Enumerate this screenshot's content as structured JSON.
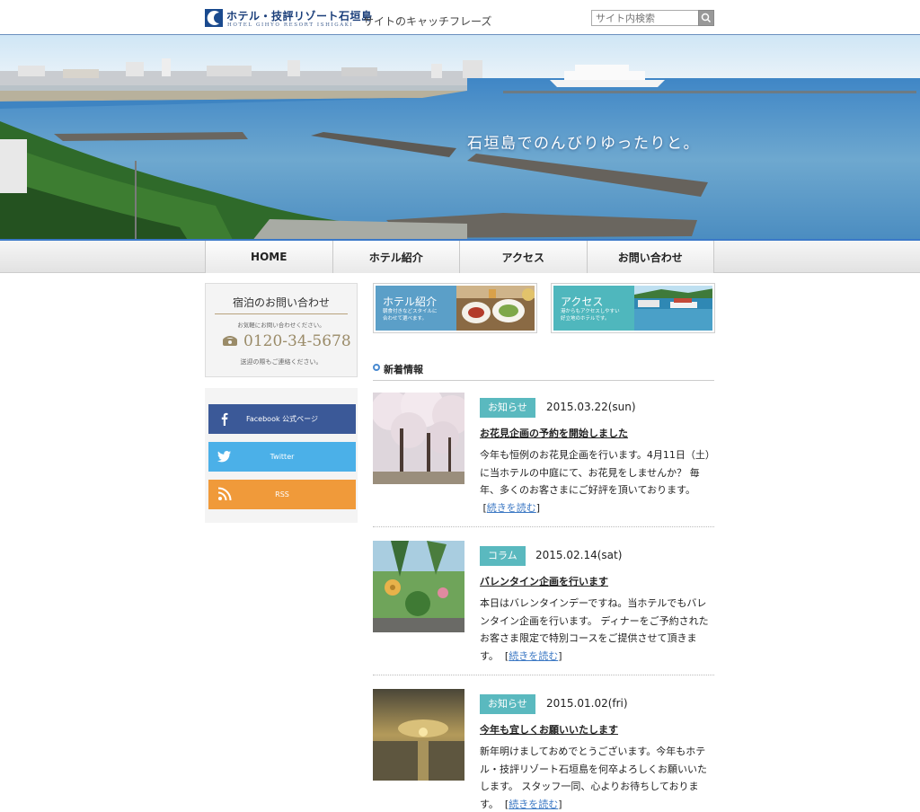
{
  "header": {
    "logo_jp": "ホテル・技評リゾート石垣島",
    "logo_en": "HOTEL GIHYO RESORT ISHIGAKI",
    "catchphrase": "サイトのキャッチフレーズ",
    "search_placeholder": "サイト内検索"
  },
  "hero": {
    "copy": "石垣島でのんびりゆったりと。"
  },
  "nav": {
    "items": [
      "HOME",
      "ホテル紹介",
      "アクセス",
      "お問い合わせ"
    ]
  },
  "contact": {
    "title": "宿泊のお問い合わせ",
    "subtitle": "お気軽にお問い合わせください。",
    "phone": "0120-34-5678",
    "note": "送迎の際もご連絡ください。"
  },
  "social": {
    "facebook": "Facebook 公式ページ",
    "twitter": "Twitter",
    "rss": "RSS"
  },
  "banners": [
    {
      "title": "ホテル紹介",
      "sub1": "朝食付きなどスタイルに",
      "sub2": "合わせて選べます。"
    },
    {
      "title": "アクセス",
      "sub1": "港からもアクセスしやすい",
      "sub2": "好立地のホテルです。"
    }
  ],
  "news": {
    "heading": "新着情報",
    "read_more": "続きを読む",
    "entries": [
      {
        "tag": "お知らせ",
        "date": "2015.03.22(sun)",
        "title": "お花見企画の予約を開始しました",
        "body": "今年も恒例のお花見企画を行います。4月11日（土）に当ホテルの中庭にて、お花見をしませんか？ 毎年、多くのお客さまにご好評を頂いております。"
      },
      {
        "tag": "コラム",
        "date": "2015.02.14(sat)",
        "title": "バレンタイン企画を行います",
        "body": "本日はバレンタインデーですね。当ホテルでもバレンタイン企画を行います。 ディナーをご予約されたお客さま限定で特別コースをご提供させて頂きます。"
      },
      {
        "tag": "お知らせ",
        "date": "2015.01.02(fri)",
        "title": "今年も宜しくお願いいたします",
        "body": "新年明けましておめでとうございます。今年もホテル・技評リゾート石垣島を何卒よろしくお願いいたします。 スタッフ一同、心よりお待ちしております。"
      }
    ]
  },
  "colors": {
    "tag": "#5ab9bf",
    "facebook": "#3b5998",
    "twitter": "#4bb0e8",
    "rss": "#f09a3a",
    "link": "#3d79c4"
  }
}
